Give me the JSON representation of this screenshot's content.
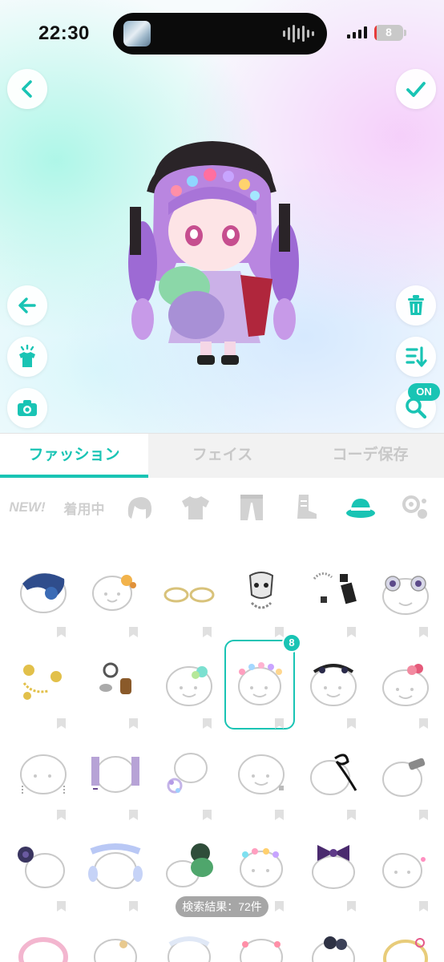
{
  "status_bar": {
    "time": "22:30",
    "battery": "8",
    "battery_level": 0.08
  },
  "preview": {
    "back_icon": "chevron-left-icon",
    "confirm_icon": "check-icon",
    "left_tools": [
      "undo-arrow-icon",
      "try-on-shirt-icon",
      "camera-icon"
    ],
    "right_tools": [
      "trash-icon",
      "sort-icon",
      "search-zoom-icon"
    ],
    "search_toggle": "ON"
  },
  "tabs": [
    {
      "label": "ファッション",
      "active": true
    },
    {
      "label": "フェイス",
      "active": false
    },
    {
      "label": "コーデ保存",
      "active": false
    }
  ],
  "categories": [
    {
      "label": "NEW!",
      "icon": "new-icon"
    },
    {
      "label": "着用中",
      "icon": "wearing-icon"
    },
    {
      "icon": "hair-icon"
    },
    {
      "icon": "tshirt-icon"
    },
    {
      "icon": "pants-icon"
    },
    {
      "icon": "boot-icon"
    },
    {
      "icon": "hat-icon",
      "active": true
    },
    {
      "icon": "accessory-icon"
    }
  ],
  "colors": {
    "accent": "#19c4b4",
    "inactive": "#c8c8c8",
    "battery_low": "#e63b3b"
  },
  "items_selected_badge": "8",
  "result_count": "検索結果：72件"
}
